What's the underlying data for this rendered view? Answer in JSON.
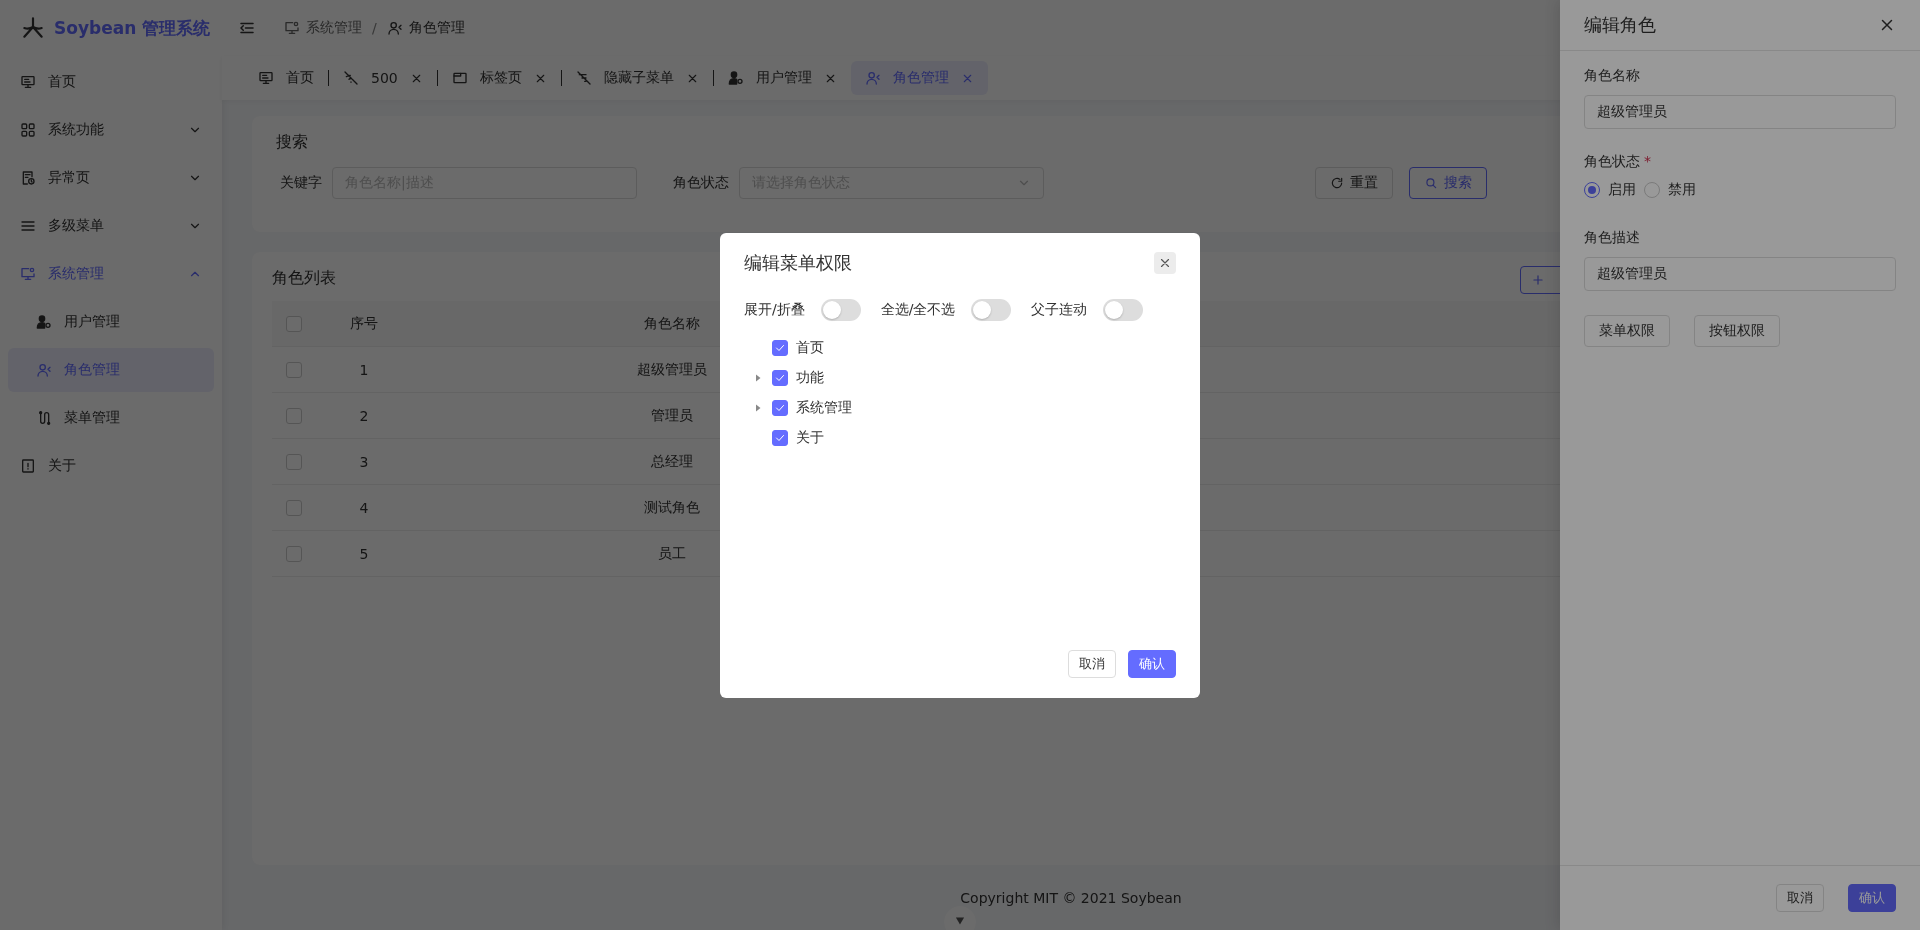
{
  "sidebar": {
    "logo_text": "Soybean 管理系统",
    "items": [
      {
        "label": "首页",
        "selected": false
      },
      {
        "label": "系统功能",
        "selected": false,
        "expanded": false
      },
      {
        "label": "异常页",
        "selected": false,
        "expanded": false
      },
      {
        "label": "多级菜单",
        "selected": false,
        "expanded": false
      },
      {
        "label": "系统管理",
        "expanded": true,
        "children": [
          {
            "label": "用户管理",
            "selected": false
          },
          {
            "label": "角色管理",
            "selected": true
          },
          {
            "label": "菜单管理",
            "selected": false
          }
        ]
      },
      {
        "label": "关于",
        "selected": false
      }
    ]
  },
  "breadcrumb": [
    {
      "label": "系统管理"
    },
    {
      "label": "角色管理"
    }
  ],
  "breadcrumb_separator": "/",
  "tabs": [
    {
      "label": "首页",
      "closable": false,
      "selected": false
    },
    {
      "label": "500",
      "closable": true,
      "selected": false
    },
    {
      "label": "标签页",
      "closable": true,
      "selected": false
    },
    {
      "label": "隐藏子菜单",
      "closable": true,
      "selected": false
    },
    {
      "label": "用户管理",
      "closable": true,
      "selected": false
    },
    {
      "label": "角色管理",
      "closable": true,
      "selected": true
    }
  ],
  "search": {
    "title": "搜索",
    "fields": [
      {
        "kind": "input",
        "label": "关键字",
        "placeholder": "角色名称|描述"
      },
      {
        "kind": "select",
        "label": "角色状态",
        "placeholder": "请选择角色状态"
      }
    ],
    "buttons": [
      {
        "kind": "reset",
        "label": "重置"
      },
      {
        "kind": "search",
        "label": "搜索"
      }
    ]
  },
  "table": {
    "title": "角色列表",
    "header_checked": false,
    "columns": [
      "序号",
      "角色名称"
    ],
    "rows": [
      {
        "checked": false,
        "index": "1",
        "name": "超级管理员"
      },
      {
        "checked": false,
        "index": "2",
        "name": "管理员"
      },
      {
        "checked": false,
        "index": "3",
        "name": "总经理"
      },
      {
        "checked": false,
        "index": "4",
        "name": "测试角色"
      },
      {
        "checked": false,
        "index": "5",
        "name": "员工"
      }
    ]
  },
  "footer": {
    "copyright": "Copyright MIT © 2021 Soybean"
  },
  "drawer": {
    "title": "编辑角色",
    "fields": [
      {
        "kind": "input",
        "label": "角色名称",
        "value": "超级管理员"
      },
      {
        "kind": "radio",
        "label": "角色状态",
        "required_mark": "*",
        "options": [
          {
            "label": "启用",
            "selected": true
          },
          {
            "label": "禁用",
            "selected": false
          }
        ]
      },
      {
        "kind": "input",
        "label": "角色描述",
        "value": "超级管理员"
      }
    ],
    "actions": [
      "菜单权限",
      "按钮权限"
    ],
    "footer_buttons": [
      {
        "kind": "default",
        "label": "取消"
      },
      {
        "kind": "primary",
        "label": "确认"
      }
    ]
  },
  "modal": {
    "title": "编辑菜单权限",
    "toggles": [
      {
        "label": "展开/折叠",
        "on": false
      },
      {
        "label": "全选/全不选",
        "on": false
      },
      {
        "label": "父子连动",
        "on": false
      }
    ],
    "tree": [
      {
        "label": "首页",
        "checked": true
      },
      {
        "label": "功能",
        "checked": true,
        "expanded": false
      },
      {
        "label": "系统管理",
        "checked": true,
        "expanded": false
      },
      {
        "label": "关于",
        "checked": true
      }
    ],
    "buttons": [
      {
        "kind": "default",
        "label": "取消"
      },
      {
        "kind": "primary",
        "label": "确认"
      }
    ]
  }
}
